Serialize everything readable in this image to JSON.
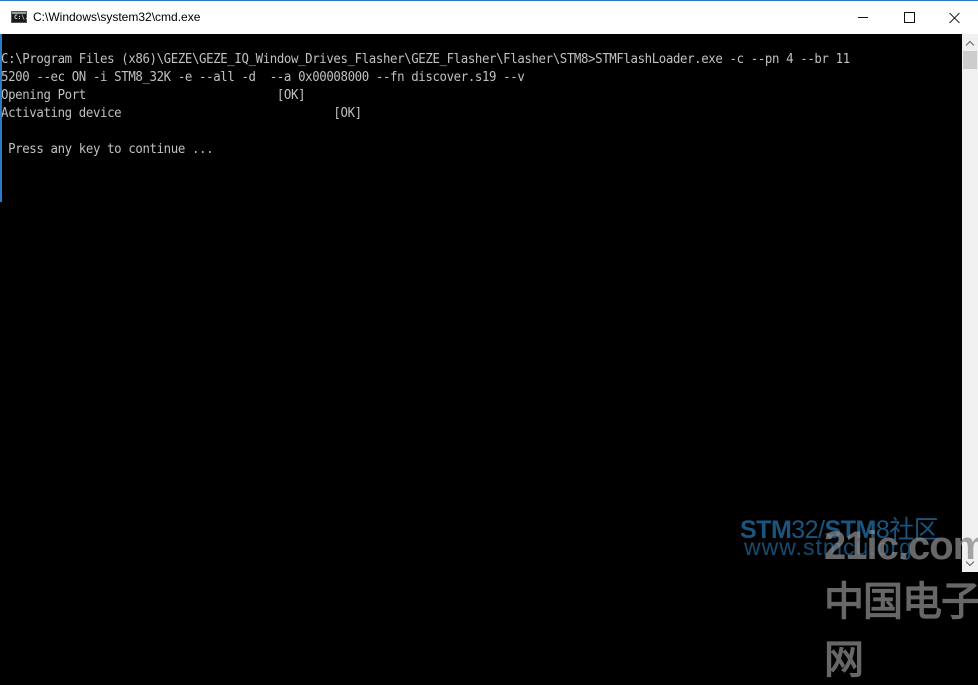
{
  "window": {
    "title": "C:\\Windows\\system32\\cmd.exe",
    "icon": "cmd-icon",
    "icon_text": "C:\\.",
    "controls": {
      "minimize": "minimize-icon",
      "maximize": "maximize-icon",
      "close": "close-icon"
    },
    "accent_color": "#2b79c9"
  },
  "console": {
    "background": "#000000",
    "foreground": "#c0c0c0",
    "lines": [
      "C:\\Program Files (x86)\\GEZE\\GEZE_IQ_Window_Drives_Flasher\\GEZE_Flasher\\Flasher\\STM8>STMFlashLoader.exe -c --pn 4 --br 11",
      "5200 --ec ON -i STM8_32K -e --all -d  --a 0x00008000 --fn discover.s19 --v",
      "Opening Port                           [OK]",
      "Activating device                              [OK]",
      "",
      " Press any key to continue ..."
    ]
  },
  "scrollbar": {
    "up_icon": "chevron-up-icon",
    "down_icon": "chevron-down-icon"
  },
  "watermark": {
    "line1_bold": "STM",
    "line1_thin": "32/",
    "line1_bold2": "STM",
    "line1_rest": "8社区",
    "line2": "www.stmcu.org",
    "line3": "21ic.com 中国电子网"
  }
}
